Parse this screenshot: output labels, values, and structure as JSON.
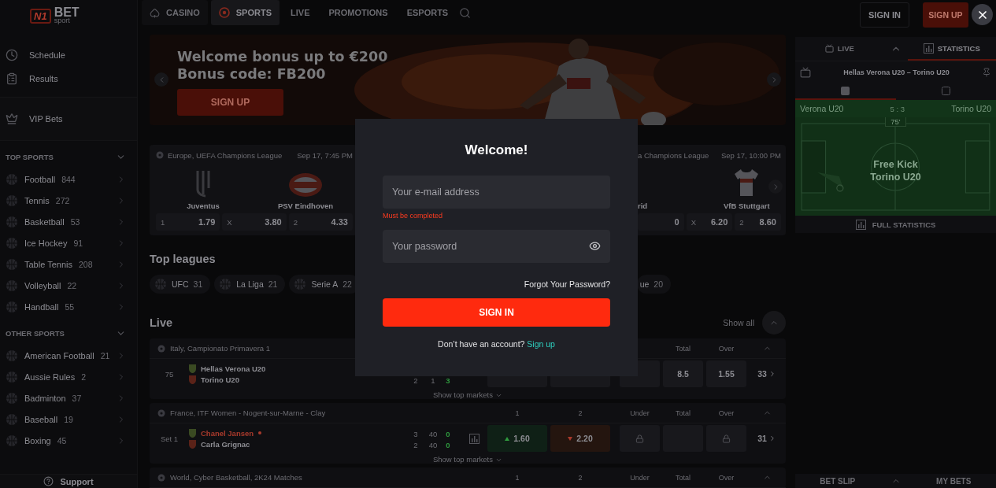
{
  "header": {
    "logo": {
      "mark": "N1",
      "word": "BET",
      "sub": "sport"
    },
    "nav": [
      {
        "label": "CASINO",
        "selected": false
      },
      {
        "label": "SPORTS",
        "selected": true
      },
      {
        "label": "LIVE",
        "selected": false
      },
      {
        "label": "PROMOTIONS",
        "selected": false
      },
      {
        "label": "ESPORTS",
        "selected": false
      }
    ],
    "sign_in": "SIGN IN",
    "sign_up": "SIGN UP"
  },
  "sidebar": {
    "links": [
      {
        "label": "Schedule"
      },
      {
        "label": "Results"
      }
    ],
    "vip": "VIP Bets",
    "sections": [
      {
        "title": "TOP SPORTS",
        "expanded": true,
        "items": [
          {
            "label": "Football",
            "count": "844"
          },
          {
            "label": "Tennis",
            "count": "272"
          },
          {
            "label": "Basketball",
            "count": "53"
          },
          {
            "label": "Ice Hockey",
            "count": "91"
          },
          {
            "label": "Table Tennis",
            "count": "208"
          },
          {
            "label": "Volleyball",
            "count": "22"
          },
          {
            "label": "Handball",
            "count": "55"
          }
        ]
      },
      {
        "title": "OTHER SPORTS",
        "expanded": true,
        "items": [
          {
            "label": "American Football",
            "count": "21"
          },
          {
            "label": "Aussie Rules",
            "count": "2"
          },
          {
            "label": "Badminton",
            "count": "37"
          },
          {
            "label": "Baseball",
            "count": "19"
          },
          {
            "label": "Boxing",
            "count": "45"
          }
        ]
      }
    ],
    "support": "Support"
  },
  "banner": {
    "lines": [
      "Welcome bonus up to €200",
      "Bonus code: FB200"
    ],
    "button": "SIGN UP"
  },
  "featured_matches": [
    {
      "kind": "full",
      "league": "Europe, UEFA Champions League",
      "time": "Sep 17, 7:45 PM",
      "home": "Juventus",
      "away": "PSV Eindhoven",
      "odds": [
        {
          "label": "1",
          "value": "1.79"
        },
        {
          "label": "X",
          "value": "3.80"
        },
        {
          "label": "2",
          "value": "4.33"
        }
      ]
    },
    {
      "kind": "covered",
      "league": "a Champions League",
      "time": "Sep 17, 10:00 PM",
      "home": "rid",
      "away": "VfB Stuttgart",
      "odds": [
        {
          "value": "0"
        },
        {
          "label": "X",
          "value": "6.20"
        },
        {
          "label": "2",
          "value": "8.60"
        }
      ]
    }
  ],
  "top_leagues": {
    "title": "Top leagues",
    "chips": [
      {
        "kind": "full",
        "name": "UFC",
        "count": "31"
      },
      {
        "kind": "full",
        "name": "La Liga",
        "count": "21"
      },
      {
        "kind": "full",
        "name": "Serie A",
        "count": "22"
      },
      {
        "kind": "covered",
        "name": "ue",
        "count": "20"
      }
    ]
  },
  "live": {
    "title": "Live",
    "show_all": "Show all",
    "groups": [
      {
        "league": "Italy, Campionato Primavera 1",
        "headers": {
          "totals": {
            "total": "Total",
            "over": "Over"
          }
        },
        "match": {
          "period": "75",
          "teams": [
            {
              "name": "Hellas Verona U20",
              "serving": false
            },
            {
              "name": "Torino U20",
              "serving": false,
              "scores": [
                "2",
                "1",
                "3"
              ]
            }
          ],
          "totals": {
            "line": {
              "value": "8.5"
            },
            "over": {
              "value": "1.55"
            }
          },
          "more": "33"
        },
        "footer": "Show top markets"
      },
      {
        "league": "France, ITF Women - Nogent-sur-Marne - Clay",
        "headers": {
          "main": [
            "1",
            "2"
          ],
          "totals": {
            "under": "Under",
            "total": "Total",
            "over": "Over"
          }
        },
        "match": {
          "period": "Set 1",
          "teams": [
            {
              "name": "Chanel Jansen",
              "serving": true,
              "scores": [
                "3",
                "40",
                "0"
              ]
            },
            {
              "name": "Carla Grignac",
              "serving": false,
              "scores": [
                "2",
                "40",
                "0"
              ]
            }
          ],
          "main": [
            {
              "value": "1.60",
              "rising": true
            },
            {
              "value": "2.20",
              "rising": false
            }
          ],
          "totals": {
            "under": {
              "locked": true
            },
            "over": {
              "locked": true
            }
          },
          "more": "31"
        },
        "footer": "Show top markets"
      },
      {
        "league": "World, Cyber Basketball, 2K24 Matches",
        "headers": {
          "main": [
            "1",
            "2"
          ],
          "totals": {
            "under": "Under",
            "total": "Total",
            "over": "Over"
          }
        }
      }
    ]
  },
  "match_panel": {
    "tabs": [
      {
        "label": "LIVE",
        "selected": false
      },
      {
        "label": "STATISTICS",
        "selected": true
      }
    ],
    "title": "Hellas Verona U20 – Torino U20",
    "views": [
      {
        "selected": true
      },
      {
        "selected": false
      }
    ],
    "home": "Verona U20",
    "score": "5 : 3",
    "away": "Torino U20",
    "minute": "75'",
    "event": "Free Kick",
    "event_team": "Torino U20",
    "full_stats": "FULL STATISTICS"
  },
  "bet_bar": {
    "bet_slip": "BET SLIP",
    "my_bets": "MY BETS"
  },
  "modal": {
    "title": "Welcome!",
    "email": {
      "placeholder": "Your e-mail address",
      "error": "Must be completed"
    },
    "password": {
      "placeholder": "Your password"
    },
    "forgot": "Forgot Your Password?",
    "submit": "SIGN IN",
    "prompt": "Don’t have an account?",
    "link": "Sign up"
  }
}
